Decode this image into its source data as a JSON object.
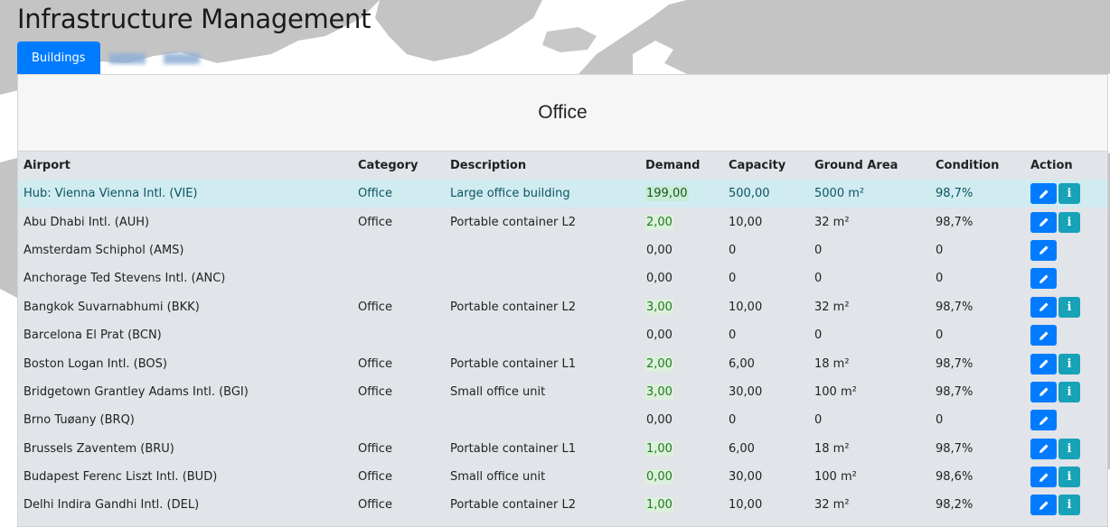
{
  "page": {
    "title": "Infrastructure Management"
  },
  "tabs": [
    {
      "label": "Buildings",
      "active": true
    }
  ],
  "panel": {
    "title": "Office"
  },
  "colors": {
    "primary": "#007bff",
    "info": "#17a2b8",
    "hub_row": "#d1ecf1",
    "panel_bg": "#e1e4e8",
    "demand_bg": "#dcf0dc",
    "demand_text": "#217a21"
  },
  "table": {
    "columns": [
      "Airport",
      "Category",
      "Description",
      "Demand",
      "Capacity",
      "Ground Area",
      "Condition",
      "Action"
    ],
    "rows": [
      {
        "airport": "Hub: Vienna Vienna Intl. (VIE)",
        "category": "Office",
        "description": "Large office building",
        "demand": "199,00",
        "capacity": "500,00",
        "ground_area": "5000 m²",
        "condition": "98,7%",
        "hub": true,
        "has_info": true,
        "demand_highlight": true
      },
      {
        "airport": "Abu Dhabi Intl. (AUH)",
        "category": "Office",
        "description": "Portable container L2",
        "demand": "2,00",
        "capacity": "10,00",
        "ground_area": "32 m²",
        "condition": "98,7%",
        "has_info": true,
        "demand_highlight": true
      },
      {
        "airport": "Amsterdam Schiphol (AMS)",
        "category": "",
        "description": "",
        "demand": "0,00",
        "capacity": "0",
        "ground_area": "0",
        "condition": "0",
        "has_info": false,
        "demand_highlight": false
      },
      {
        "airport": "Anchorage Ted Stevens Intl. (ANC)",
        "category": "",
        "description": "",
        "demand": "0,00",
        "capacity": "0",
        "ground_area": "0",
        "condition": "0",
        "has_info": false,
        "demand_highlight": false
      },
      {
        "airport": "Bangkok Suvarnabhumi (BKK)",
        "category": "Office",
        "description": "Portable container L2",
        "demand": "3,00",
        "capacity": "10,00",
        "ground_area": "32 m²",
        "condition": "98,7%",
        "has_info": true,
        "demand_highlight": true
      },
      {
        "airport": "Barcelona El Prat (BCN)",
        "category": "",
        "description": "",
        "demand": "0,00",
        "capacity": "0",
        "ground_area": "0",
        "condition": "0",
        "has_info": false,
        "demand_highlight": false
      },
      {
        "airport": "Boston Logan Intl. (BOS)",
        "category": "Office",
        "description": "Portable container L1",
        "demand": "2,00",
        "capacity": "6,00",
        "ground_area": "18 m²",
        "condition": "98,7%",
        "has_info": true,
        "demand_highlight": true
      },
      {
        "airport": "Bridgetown Grantley Adams Intl. (BGI)",
        "category": "Office",
        "description": "Small office unit",
        "demand": "3,00",
        "capacity": "30,00",
        "ground_area": "100 m²",
        "condition": "98,7%",
        "has_info": true,
        "demand_highlight": true
      },
      {
        "airport": "Brno Tuøany (BRQ)",
        "category": "",
        "description": "",
        "demand": "0,00",
        "capacity": "0",
        "ground_area": "0",
        "condition": "0",
        "has_info": false,
        "demand_highlight": false
      },
      {
        "airport": "Brussels Zaventem (BRU)",
        "category": "Office",
        "description": "Portable container L1",
        "demand": "1,00",
        "capacity": "6,00",
        "ground_area": "18 m²",
        "condition": "98,7%",
        "has_info": true,
        "demand_highlight": true
      },
      {
        "airport": "Budapest Ferenc Liszt Intl. (BUD)",
        "category": "Office",
        "description": "Small office unit",
        "demand": "0,00",
        "capacity": "30,00",
        "ground_area": "100 m²",
        "condition": "98,6%",
        "has_info": true,
        "demand_highlight": true
      },
      {
        "airport": "Delhi Indira Gandhi Intl. (DEL)",
        "category": "Office",
        "description": "Portable container L2",
        "demand": "1,00",
        "capacity": "10,00",
        "ground_area": "32 m²",
        "condition": "98,2%",
        "has_info": true,
        "demand_highlight": true
      }
    ]
  }
}
